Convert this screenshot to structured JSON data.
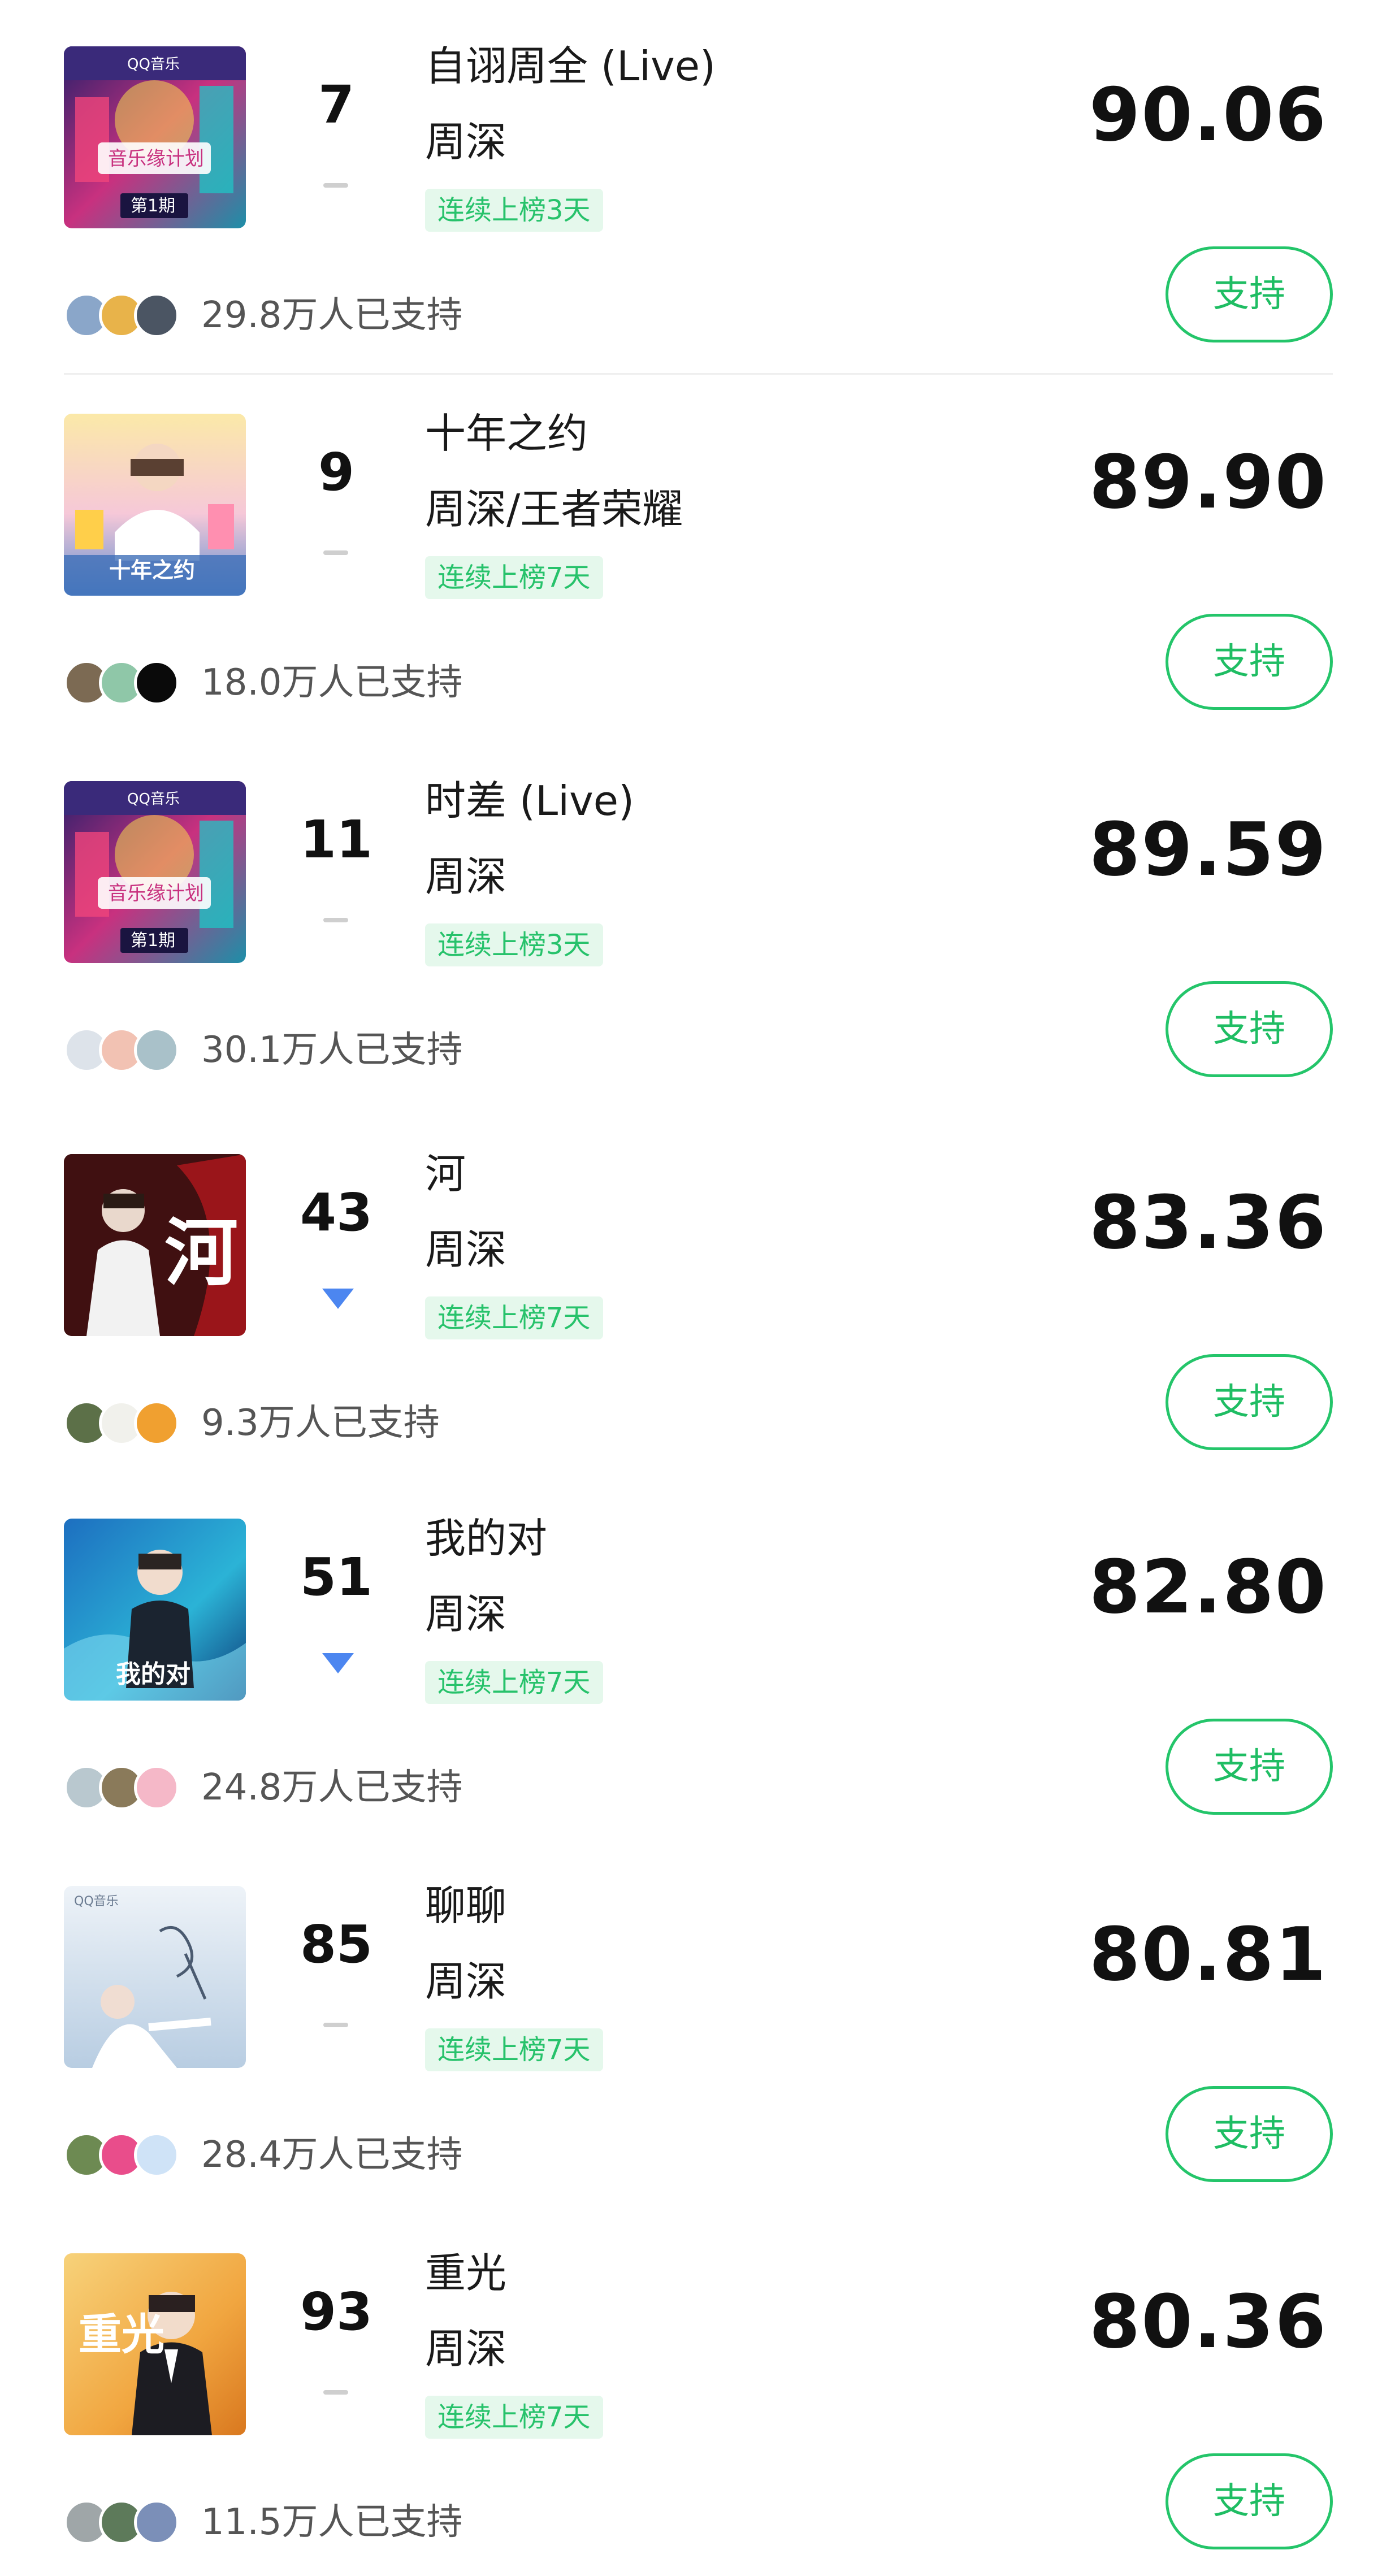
{
  "songs": [
    {
      "rank": "7",
      "trend": "flat",
      "title": "自诩周全 (Live)",
      "artist": "周深",
      "streak": "连续上榜3天",
      "score": "90.06",
      "supporters": "29.8万人已支持",
      "support_label": "支持",
      "cover": "variety-show-stage-cover-episode-1",
      "cover_text": [
        "QQ音乐",
        "音乐缘计划",
        "第1期"
      ],
      "avatar_colors": [
        "#8aa6c9",
        "#e8b34a",
        "#4b5563"
      ]
    },
    {
      "rank": "9",
      "trend": "flat",
      "title": "十年之约",
      "artist": "周深/王者荣耀",
      "streak": "连续上榜7天",
      "score": "89.90",
      "supporters": "18.0万人已支持",
      "support_label": "支持",
      "cover": "ten-year-promise-cover",
      "cover_text": [
        "十年之约"
      ],
      "avatar_colors": [
        "#7c6a53",
        "#8fc7a8",
        "#0a0a0a"
      ]
    },
    {
      "rank": "11",
      "trend": "flat",
      "title": "时差 (Live)",
      "artist": "周深",
      "streak": "连续上榜3天",
      "score": "89.59",
      "supporters": "30.1万人已支持",
      "support_label": "支持",
      "cover": "variety-show-stage-cover-episode-1",
      "cover_text": [
        "QQ音乐",
        "音乐缘计划",
        "第1期"
      ],
      "avatar_colors": [
        "#dde3ea",
        "#f2c2b3",
        "#a9c1c9"
      ]
    },
    {
      "rank": "43",
      "trend": "down",
      "title": "河",
      "artist": "周深",
      "streak": "连续上榜7天",
      "score": "83.36",
      "supporters": "9.3万人已支持",
      "support_label": "支持",
      "cover": "river-dark-red-cover",
      "cover_text": [
        "河"
      ],
      "avatar_colors": [
        "#5c7048",
        "#f1f1ec",
        "#f0a030"
      ]
    },
    {
      "rank": "51",
      "trend": "down",
      "title": "我的对",
      "artist": "周深",
      "streak": "连续上榜7天",
      "score": "82.80",
      "supporters": "24.8万人已支持",
      "support_label": "支持",
      "cover": "blue-water-portrait-cover",
      "cover_text": [
        "我的对"
      ],
      "avatar_colors": [
        "#b9c8cf",
        "#8a7a5a",
        "#f5b8c8"
      ]
    },
    {
      "rank": "85",
      "trend": "flat",
      "title": "聊聊",
      "artist": "周深",
      "streak": "连续上榜7天",
      "score": "80.81",
      "supporters": "28.4万人已支持",
      "support_label": "支持",
      "cover": "pale-blue-handwriting-cover",
      "cover_text": [
        "QQ音乐"
      ],
      "avatar_colors": [
        "#6d8a52",
        "#e94d8b",
        "#cfe3f7"
      ]
    },
    {
      "rank": "93",
      "trend": "flat",
      "title": "重光",
      "artist": "周深",
      "streak": "连续上榜7天",
      "score": "80.36",
      "supporters": "11.5万人已支持",
      "support_label": "支持",
      "cover": "golden-suit-portrait-cover",
      "cover_text": [
        "重光"
      ],
      "avatar_colors": [
        "#9fa6a8",
        "#5d7a5a",
        "#7b8fb8"
      ]
    }
  ]
}
